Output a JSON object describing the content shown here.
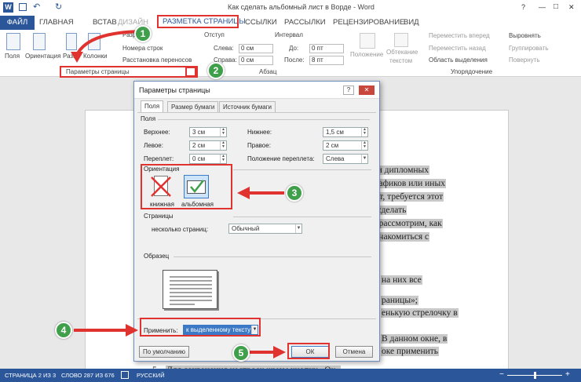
{
  "window": {
    "title": "Как сделать альбомный лист в Ворде - Word",
    "help": "?",
    "minimize": "—",
    "restore": "□",
    "close": "✕"
  },
  "ribbon_tabs": {
    "file": "ФАЙЛ",
    "home": "ГЛАВНАЯ",
    "insert": "ВСТАВ",
    "design": "ДИЗАЙН",
    "layout": "РАЗМЕТКА СТРАНИЦЫ",
    "references": "ССЫЛКИ",
    "mailings": "РАССЫЛКИ",
    "review": "РЕЦЕНЗИРОВАНИЕ",
    "view": "ВИД"
  },
  "ribbon": {
    "fields": "Поля",
    "orientation": "Ориентация",
    "size": "Разм",
    "columns": "Колонки",
    "breaks": "Разр",
    "line_numbers": "Номера строк",
    "hyphenation": "Расстановка переносов",
    "page_setup_group": "Параметры страницы",
    "indent": "Отступ",
    "indent_left_label": "Слева:",
    "indent_left_value": "0 см",
    "indent_right_label": "Справа:",
    "indent_right_value": "0 см",
    "spacing": "Интервал",
    "spacing_before_label": "До:",
    "spacing_before_value": "0 пт",
    "spacing_after_label": "После:",
    "spacing_after_value": "8 пт",
    "paragraph_group": "Абзац",
    "position": "Положение",
    "wrap_text_1": "Обтекание",
    "wrap_text_2": "текстом",
    "bring_forward": "Переместить вперед",
    "send_backward": "Переместить назад",
    "selection_pane": "Область выделения",
    "align": "Выровнять",
    "group": "Группировать",
    "rotate": "Повернуть",
    "arrange_group": "Упорядочение"
  },
  "dialog": {
    "title": "Параметры страницы",
    "help": "?",
    "close": "✕",
    "tabs": [
      "Поля",
      "Размер бумаги",
      "Источник бумаги"
    ],
    "margins_section": "Поля",
    "top_label": "Верхнее:",
    "top_value": "3 см",
    "bottom_label": "Нижнее:",
    "bottom_value": "1,5 см",
    "left_label": "Левое:",
    "left_value": "2 см",
    "right_label": "Правое:",
    "right_value": "2 см",
    "gutter_label": "Переплет:",
    "gutter_value": "0 см",
    "gutter_pos_label": "Положение переплета:",
    "gutter_pos_value": "Слева",
    "orientation_section": "Ориентация",
    "portrait": "книжная",
    "landscape": "альбомная",
    "pages_section": "Страницы",
    "multiple_pages_label": "несколько страниц:",
    "multiple_pages_value": "Обычный",
    "preview_section": "Образец",
    "apply_label": "Применить:",
    "apply_value": "к выделенному тексту",
    "default_button": "По умолчанию",
    "ok_button": "ОК",
    "cancel_button": "Отмена"
  },
  "document_lines": [
    "х и дипломных",
    "графиков или иных",
    "нст, требуется этот",
    "к сделать",
    "ы рассмотрим, как",
    "ознакомиться с",
    "на них все",
    "раницы»;",
    "енькую стрелочку в",
    "В данном окне, в",
    "оке применить",
    "Для сохранения настроек жмем кнопку «Ок»"
  ],
  "document_bullet": "5.",
  "callouts": [
    "1",
    "2",
    "3",
    "4",
    "5"
  ],
  "status": {
    "page": "СТРАНИЦА 2 ИЗ 3",
    "words": "СЛОВО 287 ИЗ 676",
    "language": "РУССКИЙ",
    "zoom_minus": "−",
    "zoom_plus": "+"
  },
  "colors": {
    "word_blue": "#2b579a",
    "callout_red": "#e0322f",
    "marker_green": "#3f9f4a"
  }
}
